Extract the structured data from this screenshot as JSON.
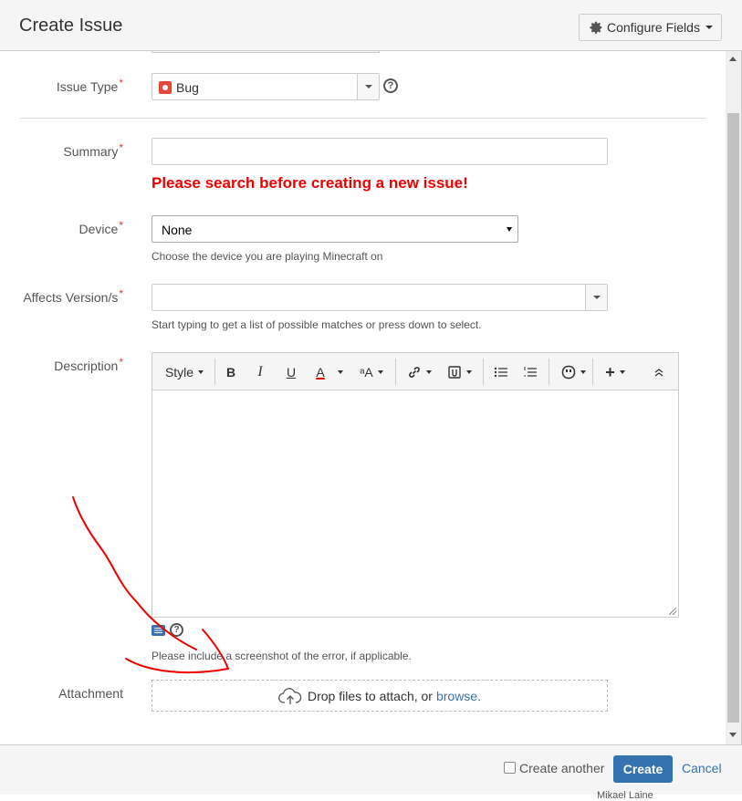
{
  "header": {
    "title": "Create Issue",
    "configure_label": "Configure Fields"
  },
  "fields": {
    "issue_type": {
      "label": "Issue Type",
      "value": "Bug"
    },
    "summary": {
      "label": "Summary",
      "value": "",
      "warning": "Please search before creating a new issue!"
    },
    "device": {
      "label": "Device",
      "value": "None",
      "hint": "Choose the device you are playing Minecraft on"
    },
    "affects_version": {
      "label": "Affects Version/s",
      "value": "",
      "hint": "Start typing to get a list of possible matches or press down to select."
    },
    "description": {
      "label": "Description",
      "hint": "Please include a screenshot of the error, if applicable."
    },
    "attachment": {
      "label": "Attachment",
      "drop_text": "Drop files to attach, or",
      "browse_link": "browse."
    }
  },
  "required_marker": "*",
  "editor_toolbar": {
    "style_label": "Style",
    "bold": "B",
    "italic": "I",
    "underline": "U",
    "text_color": "A",
    "text_effects": "ᵃA",
    "link": "link-icon",
    "attachment": "paperclip-icon",
    "bullet_list": "bullet-list-icon",
    "numbered_list": "numbered-list-icon",
    "emoticon": "emoticon-icon",
    "insert": "+",
    "collapse": "collapse-icon"
  },
  "help_glyph": "?",
  "footer": {
    "create_another_label": "Create another",
    "create_another_checked": false,
    "create_label": "Create",
    "cancel_label": "Cancel",
    "cutoff_text": "Mikael Laine"
  },
  "colors": {
    "primary": "#3572b0",
    "link": "#3b73af",
    "warning": "#e00000",
    "required": "#d04437",
    "bug": "#e5493a",
    "annotation": "#e00000"
  }
}
